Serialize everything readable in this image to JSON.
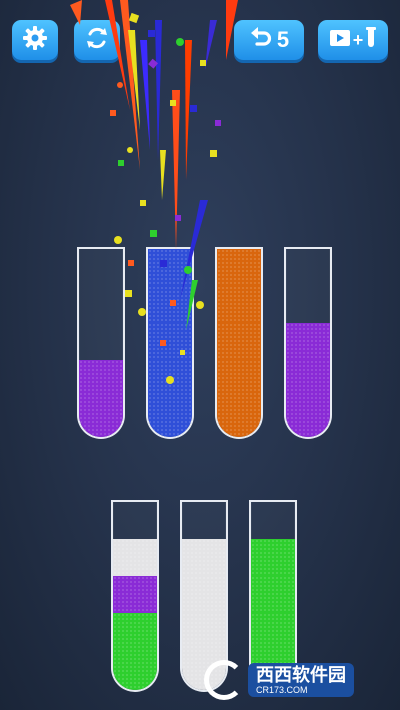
{
  "toolbar": {
    "undo_count": "5",
    "settings_icon": "gear-icon",
    "restart_icon": "restart-icon",
    "undo_icon": "undo-arrow-icon",
    "add_tube_icons": [
      "video-ad-icon",
      "plus-icon",
      "test-tube-icon"
    ],
    "add_tube_plus": "+"
  },
  "colors": {
    "purple": "#8a2bd6",
    "blue": "#2f4fd8",
    "orange": "#d9660d",
    "white": "#e4e4e6",
    "green": "#2ecf2e",
    "button": "#2fa6f5"
  },
  "tubes": [
    {
      "id": "tube-1",
      "capacity": 4,
      "layers": [
        "purple"
      ]
    },
    {
      "id": "tube-2",
      "capacity": 4,
      "layers": [
        "blue",
        "blue",
        "blue",
        "blue"
      ]
    },
    {
      "id": "tube-3",
      "capacity": 4,
      "layers": [
        "orange",
        "orange",
        "orange",
        "orange"
      ]
    },
    {
      "id": "tube-4",
      "capacity": 4,
      "layers": [
        "purple",
        "purple"
      ]
    },
    {
      "id": "tube-5",
      "capacity": 4,
      "layers": [
        "green",
        "purple",
        "white"
      ]
    },
    {
      "id": "tube-6",
      "capacity": 4,
      "layers": [
        "white",
        "white",
        "white"
      ]
    },
    {
      "id": "tube-7",
      "capacity": 4,
      "layers": [
        "green",
        "green",
        "green"
      ]
    }
  ],
  "watermark": {
    "brand": "西西软件园",
    "url": "CR173.COM"
  }
}
